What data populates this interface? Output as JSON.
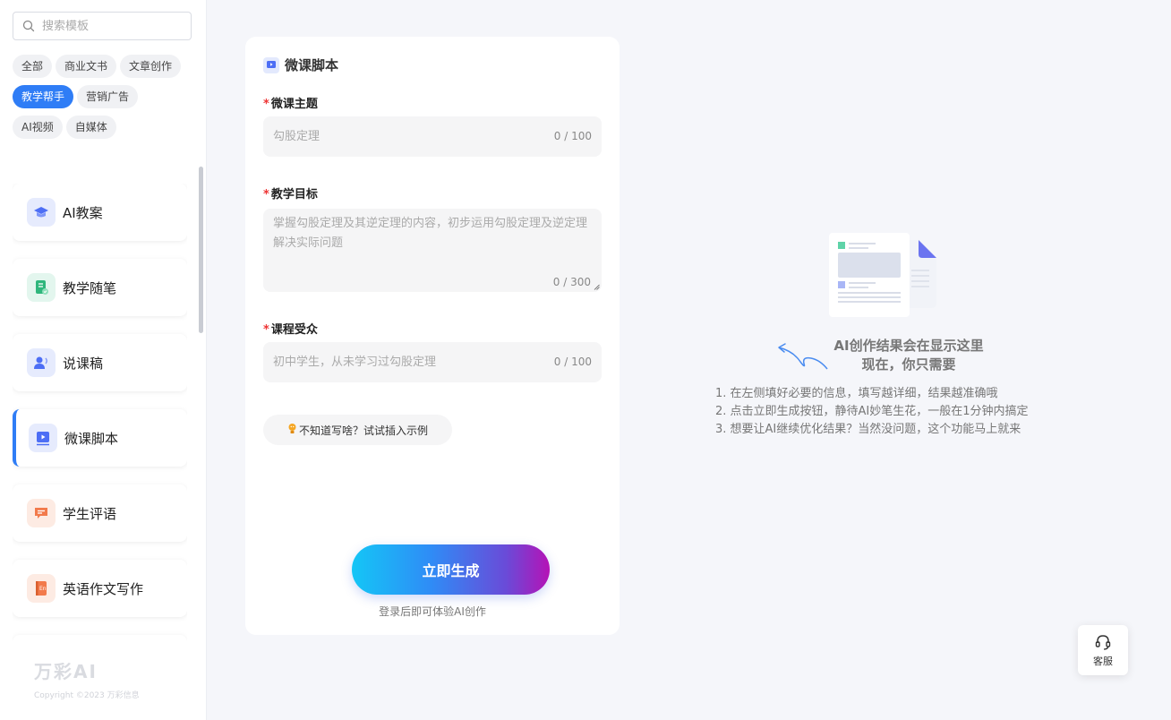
{
  "search": {
    "placeholder": "搜索模板"
  },
  "categories": [
    {
      "label": "全部"
    },
    {
      "label": "商业文书"
    },
    {
      "label": "文章创作"
    },
    {
      "label": "教学帮手",
      "active": true
    },
    {
      "label": "营销广告"
    },
    {
      "label": "AI视频"
    },
    {
      "label": "自媒体"
    }
  ],
  "templates": [
    {
      "label": "AI教案",
      "icon": "graduation-cap-icon"
    },
    {
      "label": "教学随笔",
      "icon": "note-check-icon"
    },
    {
      "label": "说课稿",
      "icon": "speaker-person-icon"
    },
    {
      "label": "微课脚本",
      "icon": "video-play-icon",
      "active": true
    },
    {
      "label": "学生评语",
      "icon": "comment-icon"
    },
    {
      "label": "英语作文写作",
      "icon": "english-book-icon"
    }
  ],
  "brand": {
    "logo": "万彩AI",
    "copyright": "Copyright ©2023 万彩信息"
  },
  "form": {
    "title": "微课脚本",
    "fields": [
      {
        "label": "微课主题",
        "placeholder": "勾股定理",
        "counter": "0 / 100"
      },
      {
        "label": "教学目标",
        "placeholder": "掌握勾股定理及其逆定理的内容，初步运用勾股定理及逆定理解决实际问题",
        "counter": "0 / 300"
      },
      {
        "label": "课程受众",
        "placeholder": "初中学生，从未学习过勾股定理",
        "counter": "0 / 100"
      }
    ],
    "example_label": "不知道写啥？试试插入示例",
    "generate_label": "立即生成",
    "login_hint": "登录后即可体验AI创作"
  },
  "result": {
    "title_line1": "AI创作结果会在显示这里",
    "title_line2": "现在，你只需要",
    "tips": [
      "1. 在左侧填好必要的信息，填写越详细，结果越准确哦",
      "2. 点击立即生成按钮，静待AI妙笔生花，一般在1分钟内搞定",
      "3. 想要让AI继续优化结果？当然没问题，这个功能马上就来"
    ]
  },
  "service": {
    "label": "客服"
  },
  "colors": {
    "accent": "#2f7df6",
    "required": "#ee3333"
  }
}
